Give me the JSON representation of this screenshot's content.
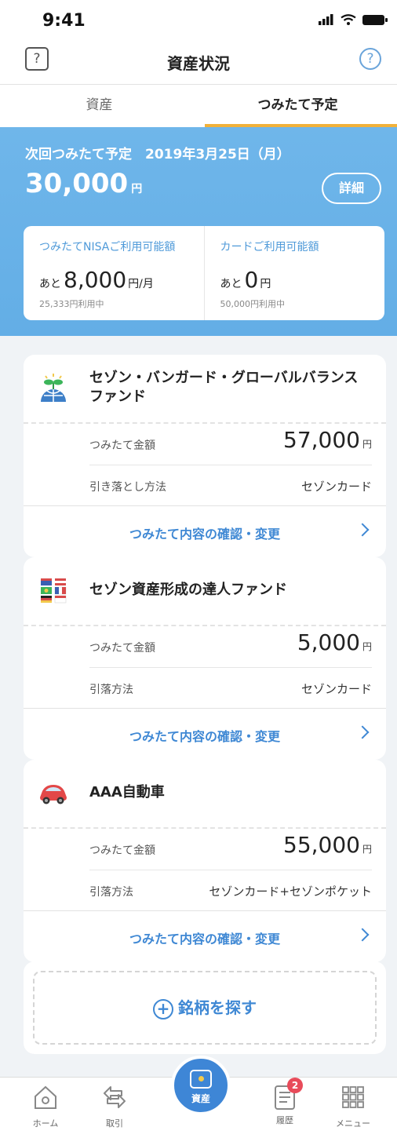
{
  "status_bar": {
    "time": "9:41"
  },
  "nav": {
    "title": "資産状況",
    "chat_glyph": "?",
    "help_glyph": "?"
  },
  "tabs": [
    {
      "label": "資産"
    },
    {
      "label": "つみたて予定"
    }
  ],
  "summary": {
    "next_date": "次回つみたて予定　2019年3月25日（月）",
    "amount": "30,000",
    "currency": "円",
    "detail_button": "詳細",
    "nisa": {
      "title": "つみたてNISAご利用可能額",
      "prefix": "あと",
      "amount": "8,000",
      "unit": "円/月",
      "used": "25,333円利用中"
    },
    "card": {
      "title": "カードご利用可能額",
      "prefix": "あと",
      "amount": "0",
      "unit": "円",
      "used": "50,000円利用中"
    }
  },
  "funds": [
    {
      "name": "セゾン・バンガード・グローバルバランスファンド",
      "amount_label": "つみたて金額",
      "amount": "57,000",
      "currency": "円",
      "method_label": "引き落とし方法",
      "method": "セゾンカード",
      "link": "つみたて内容の確認・変更",
      "icon": "globe-sprout-icon"
    },
    {
      "name": "セゾン資産形成の達人ファンド",
      "amount_label": "つみたて金額",
      "amount": "5,000",
      "currency": "円",
      "method_label": "引落方法",
      "method": "セゾンカード",
      "link": "つみたて内容の確認・変更",
      "icon": "flags-icon"
    },
    {
      "name": "AAA自動車",
      "amount_label": "つみたて金額",
      "amount": "55,000",
      "currency": "円",
      "method_label": "引落方法",
      "method": "セゾンカード+セゾンポケット",
      "link": "つみたて内容の確認・変更",
      "icon": "car-icon"
    }
  ],
  "search": {
    "label": "銘柄を探す",
    "plus": "+"
  },
  "tabbar": {
    "home": "ホーム",
    "trade": "取引",
    "assets": "資産",
    "history": "履歴",
    "history_badge": "2",
    "menu": "メニュー"
  },
  "colors": {
    "accent": "#3f88d4",
    "header_blue": "#6fb6ea",
    "tab_underline": "#f2b13a",
    "badge": "#e84b5a"
  }
}
